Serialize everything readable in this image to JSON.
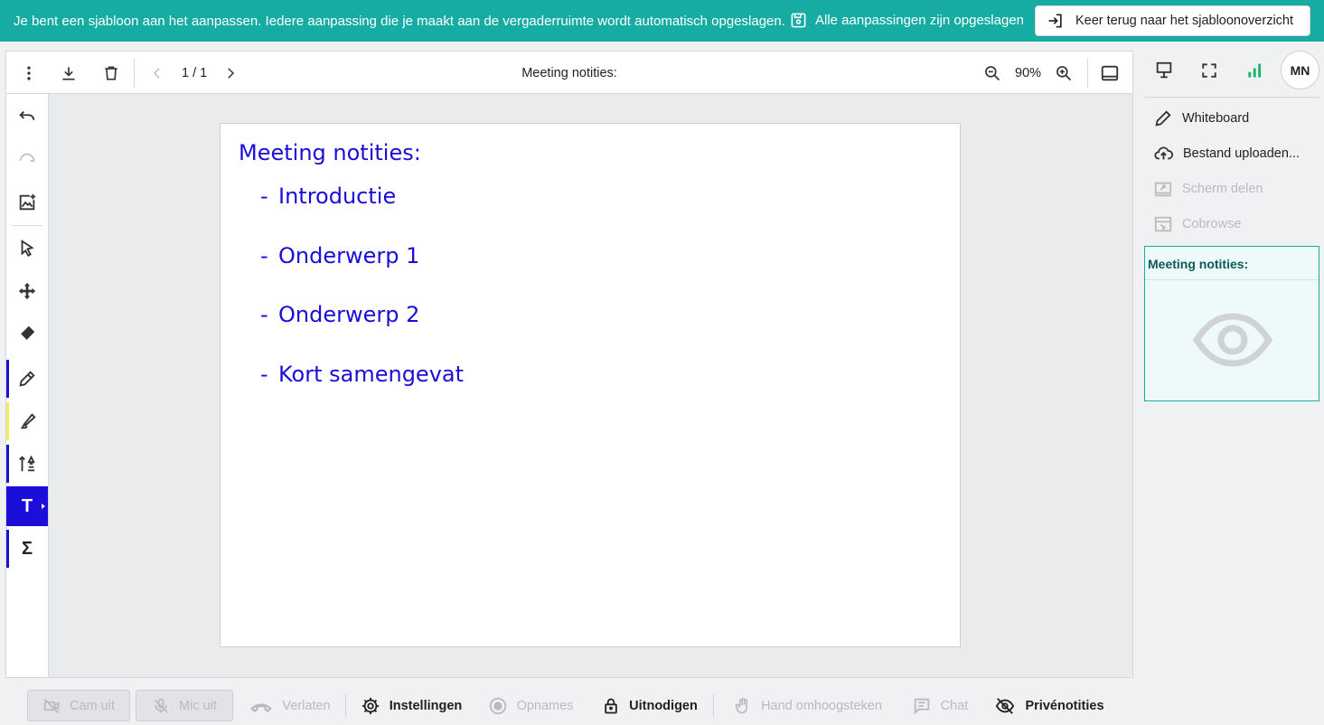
{
  "banner": {
    "message": "Je bent een sjabloon aan het aanpassen. Iedere aanpassing die je maakt aan de vergaderruimte wordt automatisch opgeslagen.",
    "saved_status": "Alle aanpassingen zijn opgeslagen",
    "back_button": "Keer terug naar het sjabloonoverzicht",
    "color": "#16aca3"
  },
  "toolbar": {
    "page_indicator": "1 / 1",
    "document_title": "Meeting notities:",
    "zoom_level": "90%"
  },
  "tools": {
    "items": [
      "undo",
      "redo",
      "add-image",
      "select",
      "move",
      "eraser",
      "pen",
      "highlighter",
      "line-width",
      "text",
      "formula"
    ],
    "active": "text",
    "text_icon": "T",
    "formula_icon": "Σ",
    "accent_color": "#1a0ed8"
  },
  "canvas": {
    "heading": "Meeting notities:",
    "bullet": "-",
    "items": [
      "Introductie",
      "Onderwerp 1",
      "Onderwerp 2",
      "Kort samengevat"
    ]
  },
  "sidebar": {
    "avatar_initials": "MN",
    "menu": [
      {
        "label": "Whiteboard",
        "icon": "pencil-icon",
        "enabled": true
      },
      {
        "label": "Bestand uploaden...",
        "icon": "cloud-upload-icon",
        "enabled": true
      },
      {
        "label": "Scherm delen",
        "icon": "screen-share-icon",
        "enabled": false
      },
      {
        "label": "Cobrowse",
        "icon": "cobrowse-icon",
        "enabled": false
      }
    ],
    "preview_title": "Meeting notities:"
  },
  "bottombar": {
    "cam": "Cam uit",
    "mic": "Mic uit",
    "leave": "Verlaten",
    "settings": "Instellingen",
    "recordings": "Opnames",
    "invite": "Uitnodigen",
    "raise_hand": "Hand omhoogsteken",
    "chat": "Chat",
    "private_notes": "Privénotities"
  }
}
